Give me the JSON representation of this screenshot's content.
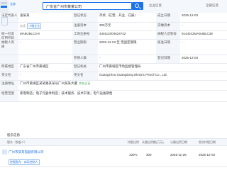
{
  "header": {
    "brand_tag": "全部",
    "search_value": "广东省广州市某某公司",
    "mid_text": "企业信息",
    "right_text": "全部信息"
  },
  "rows": [
    {
      "c1_label": "法定代表人",
      "c1_val": "张某某",
      "c2_label": "登记状态",
      "c2_val": "存续（在营、开业、在册）",
      "c3_label": "成立日期",
      "c3_val": "2025-12-03"
    },
    {
      "c1_label": "",
      "c1_val": "",
      "c2_label": "注册资本",
      "c2_val": "300万元",
      "c3_label": "实缴资本",
      "c3_val": "-"
    },
    {
      "c1_label": "统一社会信用代码",
      "c1_val": "MA9UBLC3-9",
      "c2_label": "工商注册号",
      "c2_val": "440112000624742",
      "c3_label": "纳税人识别号",
      "c3_val": "9144012MA9UBLC39"
    },
    {
      "c1_label": "纳税人资质",
      "c1_val": "-",
      "c2_label": "营业期限",
      "c2_val": "2025-12-03 至 无固定期限",
      "c3_label": "核准日期",
      "c3_val": "-"
    },
    {
      "c1_label": "",
      "c1_val": "",
      "c2_label": "参保人数",
      "c2_val": "-",
      "c3_label": "登记日期",
      "c3_val": "2025-12-03"
    },
    {
      "c1_label": "所属地区",
      "c1_val": "广东省广州市黄埔区",
      "c2_label": "登记机关",
      "c2_val": "广州市黄埔区市场监督管理局",
      "c3_label": "",
      "c3_val": ""
    },
    {
      "c1_label": "英文名",
      "c1_val": "-",
      "c2_label": "英文名",
      "c2_val": "Guangzhou Guangdong Electric Pencil Co., Ltd.",
      "c3_label": "",
      "c3_val": ""
    },
    {
      "c1_label": "注册地址",
      "c1_val": "广州市黄埔区某某路某某号广州某某大厦",
      "c2_label": "",
      "c2_val": "",
      "c3_label": "",
      "c3_val": ""
    },
    {
      "c1_label": "经营范围",
      "c1_val": "家电制造；电子元器件制造；技术服务、技术开发；电气设备销售",
      "c2_label": "",
      "c2_val": "",
      "c3_label": "",
      "c3_val": ""
    }
  ],
  "tags": {
    "logo_tag": "存续",
    "status_tag": "小微企业",
    "verified": "实名认证"
  },
  "shareholders": {
    "tab_active": "股东信息",
    "tab_other": "1",
    "headers": [
      "股东（发起人）",
      "持股比例",
      "认缴出资额(万元)",
      "认缴出资日期",
      "首次持股日期"
    ],
    "row": {
      "name": "广州市某某电器有限公司",
      "ratio": "100%",
      "amount": "300",
      "date": "2045-11-26",
      "first": "2025-12-03",
      "sub_tag": "控股股东 · 实际控制人"
    }
  },
  "colors": {
    "accent": "#1a73e8",
    "label_bg": "#f3f6fa",
    "line": "#e6ebf1"
  }
}
